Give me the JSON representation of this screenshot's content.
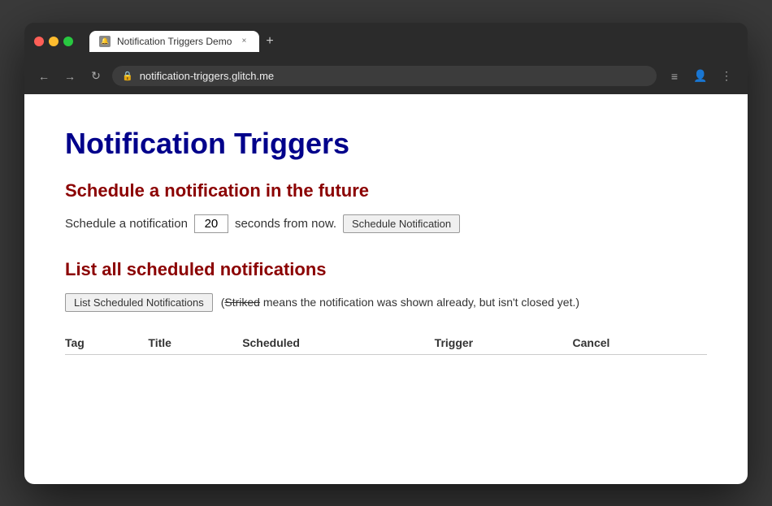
{
  "browser": {
    "tab_title": "Notification Triggers Demo",
    "tab_favicon": "🔔",
    "close_icon": "×",
    "new_tab_icon": "+",
    "back_icon": "←",
    "forward_icon": "→",
    "reload_icon": "↻",
    "url": "notification-triggers.glitch.me",
    "lock_icon": "🔒",
    "menu_icon": "≡",
    "account_icon": "👤",
    "more_icon": "⋮"
  },
  "page": {
    "title": "Notification Triggers",
    "section1_title": "Schedule a notification in the future",
    "schedule_label_before": "Schedule a notification",
    "schedule_seconds_value": "20",
    "schedule_label_after": "seconds from now.",
    "schedule_button": "Schedule Notification",
    "section2_title": "List all scheduled notifications",
    "list_button": "List Scheduled Notifications",
    "striked_note_pre": "(",
    "striked_word": "Striked",
    "striked_note_post": " means the notification was shown already, but isn't closed yet.)",
    "table_headers": [
      "Tag",
      "Title",
      "Scheduled",
      "Trigger",
      "Cancel"
    ]
  }
}
